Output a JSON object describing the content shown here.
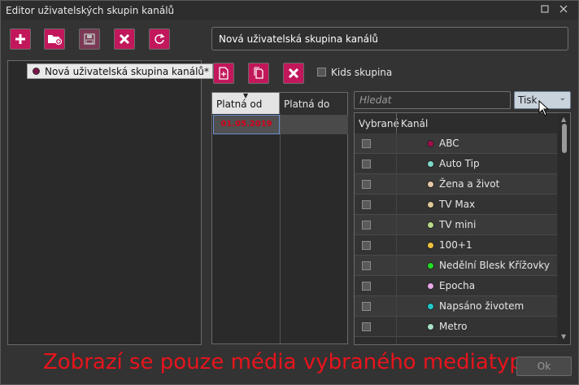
{
  "window": {
    "title": "Editor uživatelských skupin kanálů"
  },
  "toolbar": {
    "add": "add-icon",
    "new_folder": "folder-add-icon",
    "save": "save-icon",
    "delete": "delete-icon",
    "refresh": "refresh-icon"
  },
  "name_field": {
    "value": "Nová uživatelská skupina kanálů"
  },
  "tree": {
    "items": [
      {
        "label": "Nová uživatelská skupina kanálů*",
        "dot_color": "#7b1245"
      }
    ]
  },
  "mid_toolbar": {
    "kids_label": "Kids skupina"
  },
  "dates": {
    "col_from": "Platná od",
    "col_to": "Platná do",
    "rows": [
      {
        "from": "01.05.2019",
        "to": ""
      }
    ]
  },
  "channels": {
    "search_placeholder": "Hledat",
    "select_value": "Tisk",
    "col_selected": "Vybrané",
    "col_channel": "Kanál",
    "rows": [
      {
        "name": "ABC",
        "color": "#9b1048"
      },
      {
        "name": "Auto Tip",
        "color": "#7ed8c8"
      },
      {
        "name": "Žena a život",
        "color": "#e6c9a8"
      },
      {
        "name": "TV Max",
        "color": "#e0c89a"
      },
      {
        "name": "TV mini",
        "color": "#b9d98a"
      },
      {
        "name": "100+1",
        "color": "#f0c040"
      },
      {
        "name": "Nedělní Blesk Křížovky",
        "color": "#22dd22"
      },
      {
        "name": "Epocha",
        "color": "#e8a8e8"
      },
      {
        "name": "Napsáno životem",
        "color": "#20c8c8"
      },
      {
        "name": "Metro",
        "color": "#a8e0c8"
      }
    ]
  },
  "footer": {
    "message": "Zobrazí se pouze média vybraného mediatypu",
    "ok": "Ok"
  }
}
